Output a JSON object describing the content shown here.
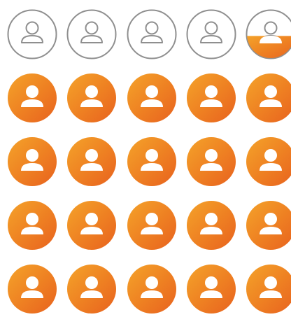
{
  "colors": {
    "orange_start": "#f08a24",
    "orange_end": "#e86a1f",
    "outline_gray": "#8f8f8f",
    "white": "#ffffff"
  },
  "icon_grid": {
    "icon": "person-icon",
    "rows": 5,
    "columns": 5,
    "total_icons": 25,
    "filled_icons": 20.3,
    "filled_fraction": 0.812
  }
}
